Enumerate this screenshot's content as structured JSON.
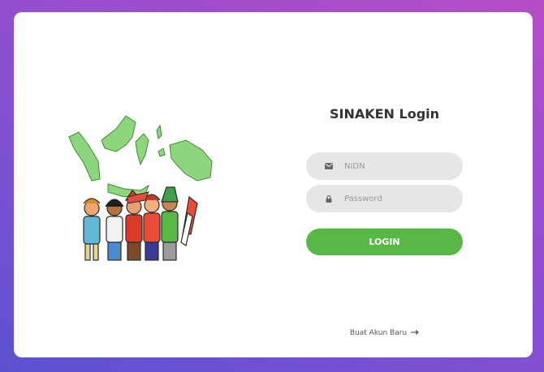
{
  "login": {
    "title": "SINAKEN Login",
    "nidn": {
      "placeholder": "NIDN",
      "icon": "envelope-icon"
    },
    "password": {
      "placeholder": "Password",
      "icon": "lock-icon"
    },
    "login_label": "LOGIN",
    "create_account_label": "Buat Akun Baru",
    "create_account_icon": "arrow-right-icon"
  },
  "colors": {
    "accent_green": "#57b846",
    "field_bg": "#e6e6e6",
    "gradient_start": "#5b52d0",
    "gradient_end": "#b64ec6"
  },
  "illustration": {
    "icon": "indonesia-map-people-illustration"
  }
}
